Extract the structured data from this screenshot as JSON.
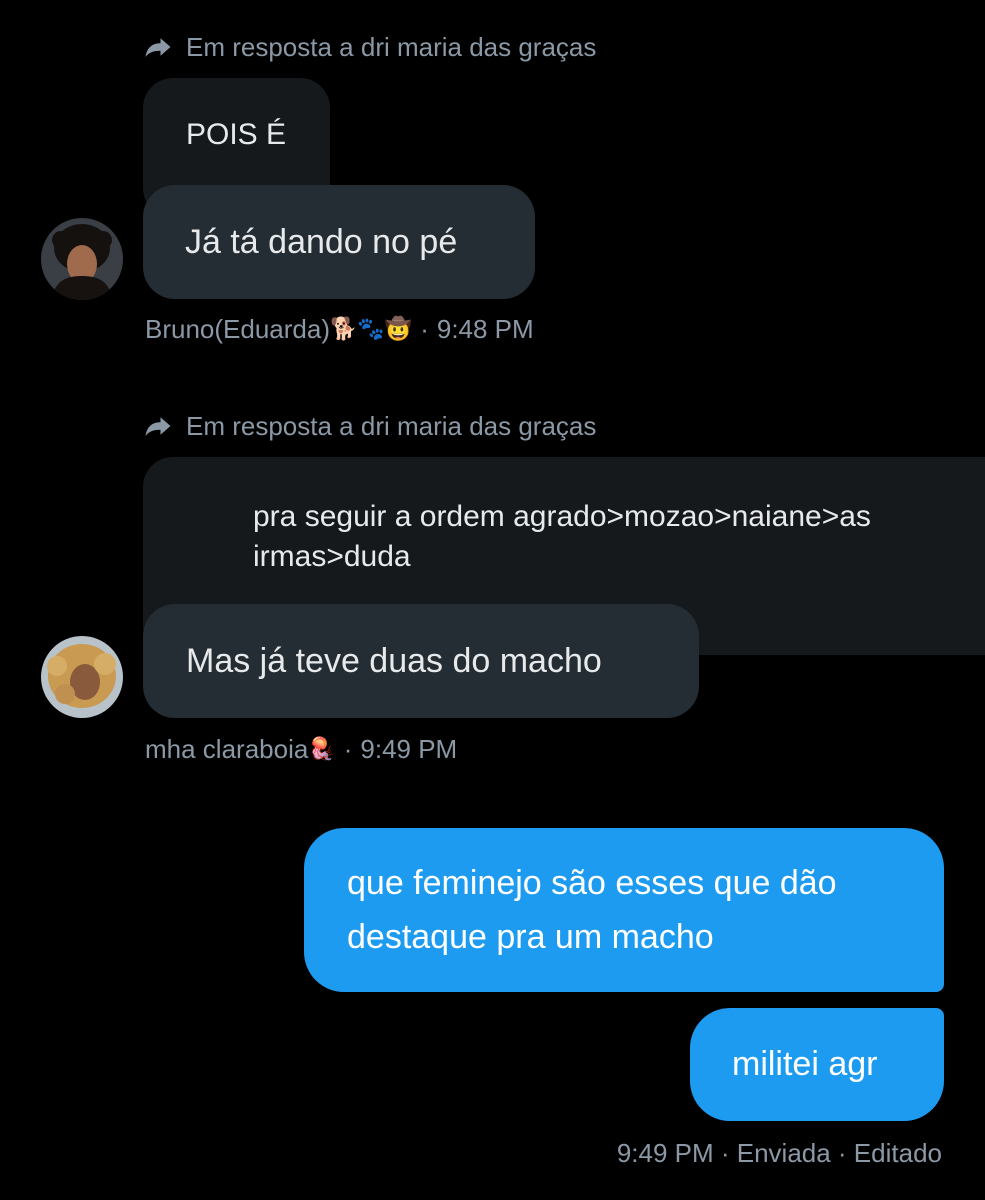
{
  "colors": {
    "background": "#000000",
    "received_bubble": "#242d34",
    "quoted_bubble": "#16191c",
    "sent_bubble": "#1d9bf0",
    "secondary_text": "#8b98a5"
  },
  "messages": [
    {
      "reply_to": "Em resposta a dri maria das graças",
      "quoted_text": "POIS É",
      "text": "Já tá dando no pé",
      "author": "Bruno(Eduarda)",
      "author_emojis": "🐕🐾🤠",
      "time": "9:48 PM",
      "avatar_icon": "avatar-dark-curly-hair"
    },
    {
      "reply_to": "Em resposta a dri maria das graças",
      "quoted_text": "pra seguir a ordem agrado>mozao>naiane>as irmas>duda",
      "text": "Mas já teve duas do macho",
      "author": "mha claraboia",
      "author_emojis": "🪼",
      "time": "9:49 PM",
      "avatar_icon": "avatar-blonde-curly-hair"
    }
  ],
  "sent": {
    "messages": [
      "que feminejo são esses que dão destaque pra um macho",
      "militei agr"
    ],
    "meta": "9:49 PM · Enviada · Editado"
  },
  "separator": "·"
}
